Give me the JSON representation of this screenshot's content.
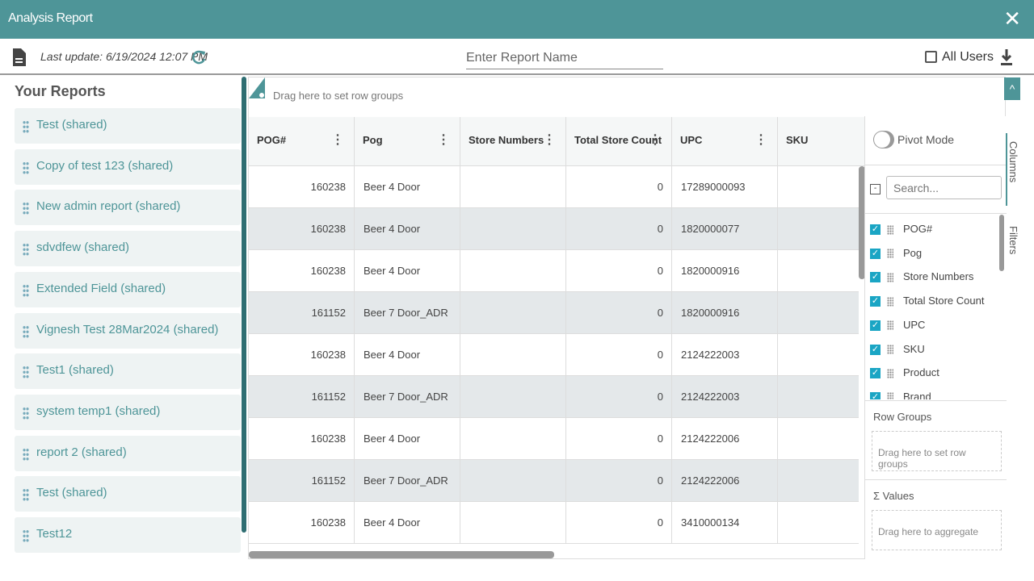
{
  "header": {
    "title": "Analysis Report",
    "close": "✕"
  },
  "toolbar": {
    "last_update": "Last update: 6/19/2024 12:07 PM",
    "report_name_placeholder": "Enter Report Name",
    "all_users_label": "All Users"
  },
  "left": {
    "title": "Your Reports",
    "items": [
      "Test (shared)",
      "Copy of test 123 (shared)",
      "New admin report (shared)",
      "sdvdfew (shared)",
      "Extended Field (shared)",
      "Vignesh Test 28Mar2024 (shared)",
      "Test1 (shared)",
      "system temp1 (shared)",
      "report 2 (shared)",
      "Test (shared)",
      "Test12"
    ]
  },
  "grid": {
    "drag_row_groups": "Drag here to set row groups",
    "columns": [
      "POG#",
      "Pog",
      "Store Numbers",
      "Total Store Count",
      "UPC",
      "SKU"
    ],
    "rows": [
      [
        "160238",
        "Beer 4 Door",
        "",
        "0",
        "17289000093",
        ""
      ],
      [
        "160238",
        "Beer 4 Door",
        "",
        "0",
        "1820000077",
        ""
      ],
      [
        "160238",
        "Beer 4 Door",
        "",
        "0",
        "1820000916",
        ""
      ],
      [
        "161152",
        "Beer 7 Door_ADR",
        "",
        "0",
        "1820000916",
        ""
      ],
      [
        "160238",
        "Beer 4 Door",
        "",
        "0",
        "2124222003",
        ""
      ],
      [
        "161152",
        "Beer 7 Door_ADR",
        "",
        "0",
        "2124222003",
        ""
      ],
      [
        "160238",
        "Beer 4 Door",
        "",
        "0",
        "2124222006",
        ""
      ],
      [
        "161152",
        "Beer 7 Door_ADR",
        "",
        "0",
        "2124222006",
        ""
      ],
      [
        "160238",
        "Beer 4 Door",
        "",
        "0",
        "3410000134",
        ""
      ]
    ]
  },
  "side": {
    "pivot_mode": "Pivot Mode",
    "pivot_on": false,
    "search_placeholder": "Search...",
    "columns": [
      "POG#",
      "Pog",
      "Store Numbers",
      "Total Store Count",
      "UPC",
      "SKU",
      "Product",
      "Brand"
    ],
    "row_groups": "Row Groups",
    "row_groups_drop": "Drag here to set row groups",
    "values": "Values",
    "values_drop": "Drag here to aggregate",
    "tab_columns": "Columns",
    "tab_filters": "Filters"
  },
  "colors": {
    "accent": "#4e9598",
    "checkbox": "#1aa5c4"
  }
}
